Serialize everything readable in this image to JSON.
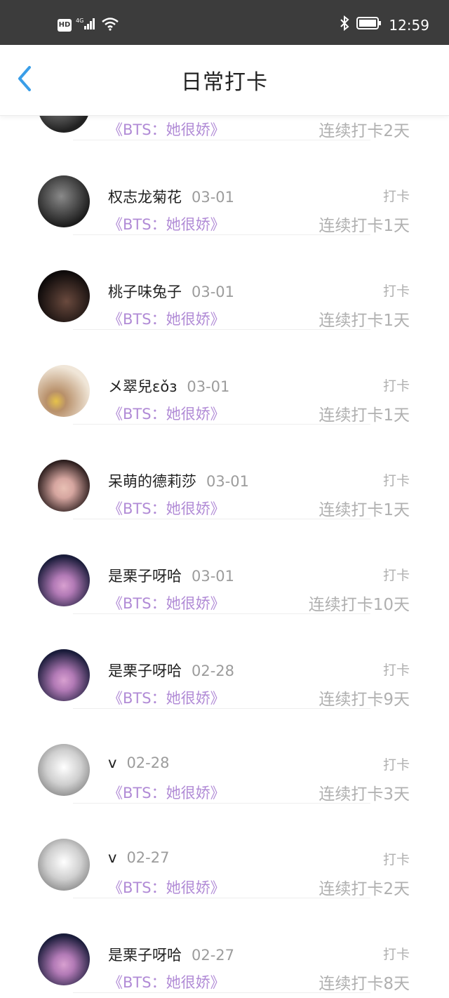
{
  "status_bar": {
    "network": "4G",
    "hd_label": "HD",
    "time": "12:59"
  },
  "header": {
    "title": "日常打卡"
  },
  "rows": [
    {
      "name": "",
      "date": "",
      "book": "《BTS：她很娇》",
      "tag": "",
      "streak": "连续打卡2天",
      "avatar_colors": [
        "#222",
        "#999"
      ]
    },
    {
      "name": "权志龙菊花",
      "date": "03-01",
      "book": "《BTS：她很娇》",
      "tag": "打卡",
      "streak": "连续打卡1天",
      "avatar_colors": [
        "#1b1b1b",
        "#8a8a8a"
      ]
    },
    {
      "name": "桃子味兔子",
      "date": "03-01",
      "book": "《BTS：她很娇》",
      "tag": "打卡",
      "streak": "连续打卡1天",
      "avatar_colors": [
        "#0e0a0a",
        "#6a4a3e"
      ]
    },
    {
      "name": "メ翠兒ɛǒɜ",
      "date": "03-01",
      "book": "《BTS：她很娇》",
      "tag": "打卡",
      "streak": "连续打卡1天",
      "avatar_colors": [
        "#f0e6d8",
        "#b8906a"
      ]
    },
    {
      "name": "呆萌的德莉莎",
      "date": "03-01",
      "book": "《BTS：她很娇》",
      "tag": "打卡",
      "streak": "连续打卡1天",
      "avatar_colors": [
        "#2a1c1c",
        "#d6a6a0"
      ]
    },
    {
      "name": "是栗子呀哈",
      "date": "03-01",
      "book": "《BTS：她很娇》",
      "tag": "打卡",
      "streak": "连续打卡10天",
      "avatar_colors": [
        "#1a1c3a",
        "#b27ab6"
      ]
    },
    {
      "name": "是栗子呀哈",
      "date": "02-28",
      "book": "《BTS：她很娇》",
      "tag": "打卡",
      "streak": "连续打卡9天",
      "avatar_colors": [
        "#1a1c3a",
        "#b27ab6"
      ]
    },
    {
      "name": "v",
      "date": "02-28",
      "book": "《BTS：她很娇》",
      "tag": "打卡",
      "streak": "连续打卡3天",
      "avatar_colors": [
        "#ffffff",
        "#777777"
      ]
    },
    {
      "name": "v",
      "date": "02-27",
      "book": "《BTS：她很娇》",
      "tag": "打卡",
      "streak": "连续打卡2天",
      "avatar_colors": [
        "#ffffff",
        "#777777"
      ]
    },
    {
      "name": "是栗子呀哈",
      "date": "02-27",
      "book": "《BTS：她很娇》",
      "tag": "打卡",
      "streak": "连续打卡8天",
      "avatar_colors": [
        "#1a1c3a",
        "#b27ab6"
      ]
    }
  ]
}
